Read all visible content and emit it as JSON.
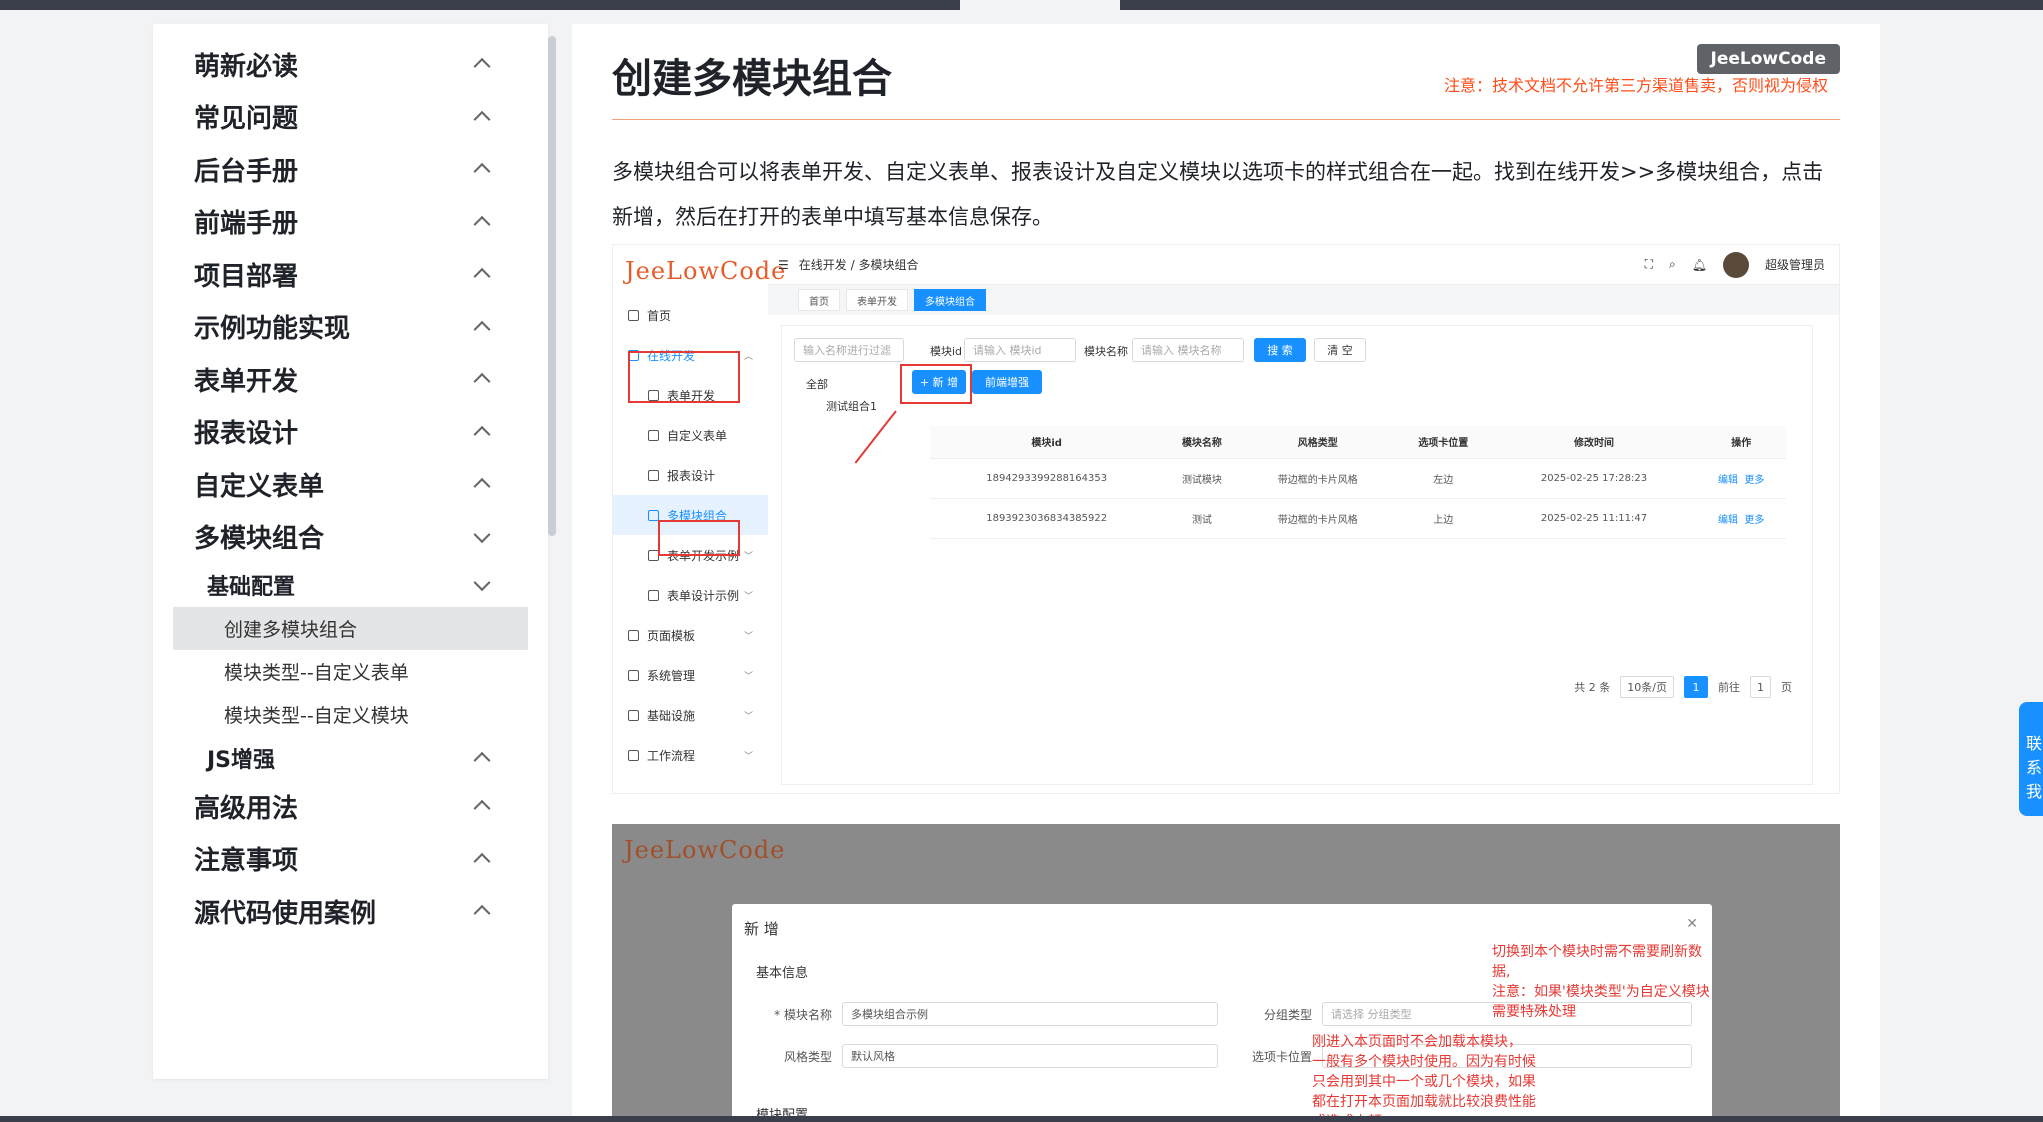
{
  "sidebar": {
    "items": [
      {
        "label": "萌新必读"
      },
      {
        "label": "常见问题"
      },
      {
        "label": "后台手册"
      },
      {
        "label": "前端手册"
      },
      {
        "label": "项目部署"
      },
      {
        "label": "示例功能实现"
      },
      {
        "label": "表单开发"
      },
      {
        "label": "报表设计"
      },
      {
        "label": "自定义表单"
      },
      {
        "label": "多模块组合"
      }
    ],
    "sub": {
      "label": "基础配置"
    },
    "leaves": [
      {
        "label": "创建多模块组合"
      },
      {
        "label": "模块类型--自定义表单"
      },
      {
        "label": "模块类型--自定义模块"
      }
    ],
    "sub2": {
      "label": "JS增强"
    },
    "after": [
      {
        "label": "高级用法"
      },
      {
        "label": "注意事项"
      },
      {
        "label": "源代码使用案例"
      }
    ]
  },
  "article": {
    "title": "创建多模块组合",
    "brand": "JeeLowCode",
    "notice": "注意：技术文档不允许第三方渠道售卖，否则视为侵权",
    "paragraph": "多模块组合可以将表单开发、自定义表单、报表设计及自定义模块以选项卡的样式组合在一起。找到在线开发>>多模块组合，点击新增，然后在打开的表单中填写基本信息保存。"
  },
  "shot1": {
    "logo": "JeeLowCode",
    "menu": [
      {
        "label": "首页"
      },
      {
        "label": "在线开发"
      },
      {
        "label": "表单开发"
      },
      {
        "label": "自定义表单"
      },
      {
        "label": "报表设计"
      },
      {
        "label": "多模块组合"
      },
      {
        "label": "表单开发示例"
      },
      {
        "label": "表单设计示例"
      },
      {
        "label": "页面模板"
      },
      {
        "label": "系统管理"
      },
      {
        "label": "基础设施"
      },
      {
        "label": "工作流程"
      }
    ],
    "breadcrumb": "在线开发  /  多模块组合",
    "user": "超级管理员",
    "tabs": [
      "首页",
      "表单开发",
      "多模块组合"
    ],
    "tree_search": "输入名称进行过滤",
    "tree_all": "全部",
    "tree_node": "测试组合1",
    "f_id_label": "模块id",
    "f_id_ph": "请输入 模块id",
    "f_name_label": "模块名称",
    "f_name_ph": "请输入 模块名称",
    "search_btn": "搜 索",
    "clear_btn": "清 空",
    "add_btn": "+ 新 增",
    "enhance_btn": "前端增强",
    "headers": [
      "模块id",
      "模块名称",
      "风格类型",
      "选项卡位置",
      "修改时间",
      "操作"
    ],
    "rows": [
      {
        "id": "1894293399288164353",
        "name": "测试模块",
        "style": "带边框的卡片风格",
        "pos": "左边",
        "time": "2025-02-25 17:28:23",
        "edit": "编辑",
        "more": "更多"
      },
      {
        "id": "1893923036834385922",
        "name": "测试",
        "style": "带边框的卡片风格",
        "pos": "上边",
        "time": "2025-02-25 11:11:47",
        "edit": "编辑",
        "more": "更多"
      }
    ],
    "total": "共 2 条",
    "page_size": "10条/页",
    "page": "1",
    "goto": "前往",
    "goto_val": "1",
    "page_unit": "页"
  },
  "shot2": {
    "dialog_title": "新 增",
    "section": "基本信息",
    "name_label": "* 模块名称",
    "name_val": "多模块组合示例",
    "group_label": "分组类型",
    "group_ph": "请选择 分组类型",
    "style_label": "风格类型",
    "style_val": "默认风格",
    "tab_label": "选项卡位置",
    "module_cfg": "模块配置",
    "anno1": "切换到本个模块时需不需要刷新数据,\n注意：如果'模块类型'为自定义模块\n需要特殊处理",
    "anno2": "刚进入本页面时不会加载本模块，\n一般有多个模块时使用。因为有时候\n只会用到其中一个或几个模块，如果\n都在打开本页面加载就比较浪费性能\n或造成卡顿"
  },
  "side_tab": "联系我"
}
